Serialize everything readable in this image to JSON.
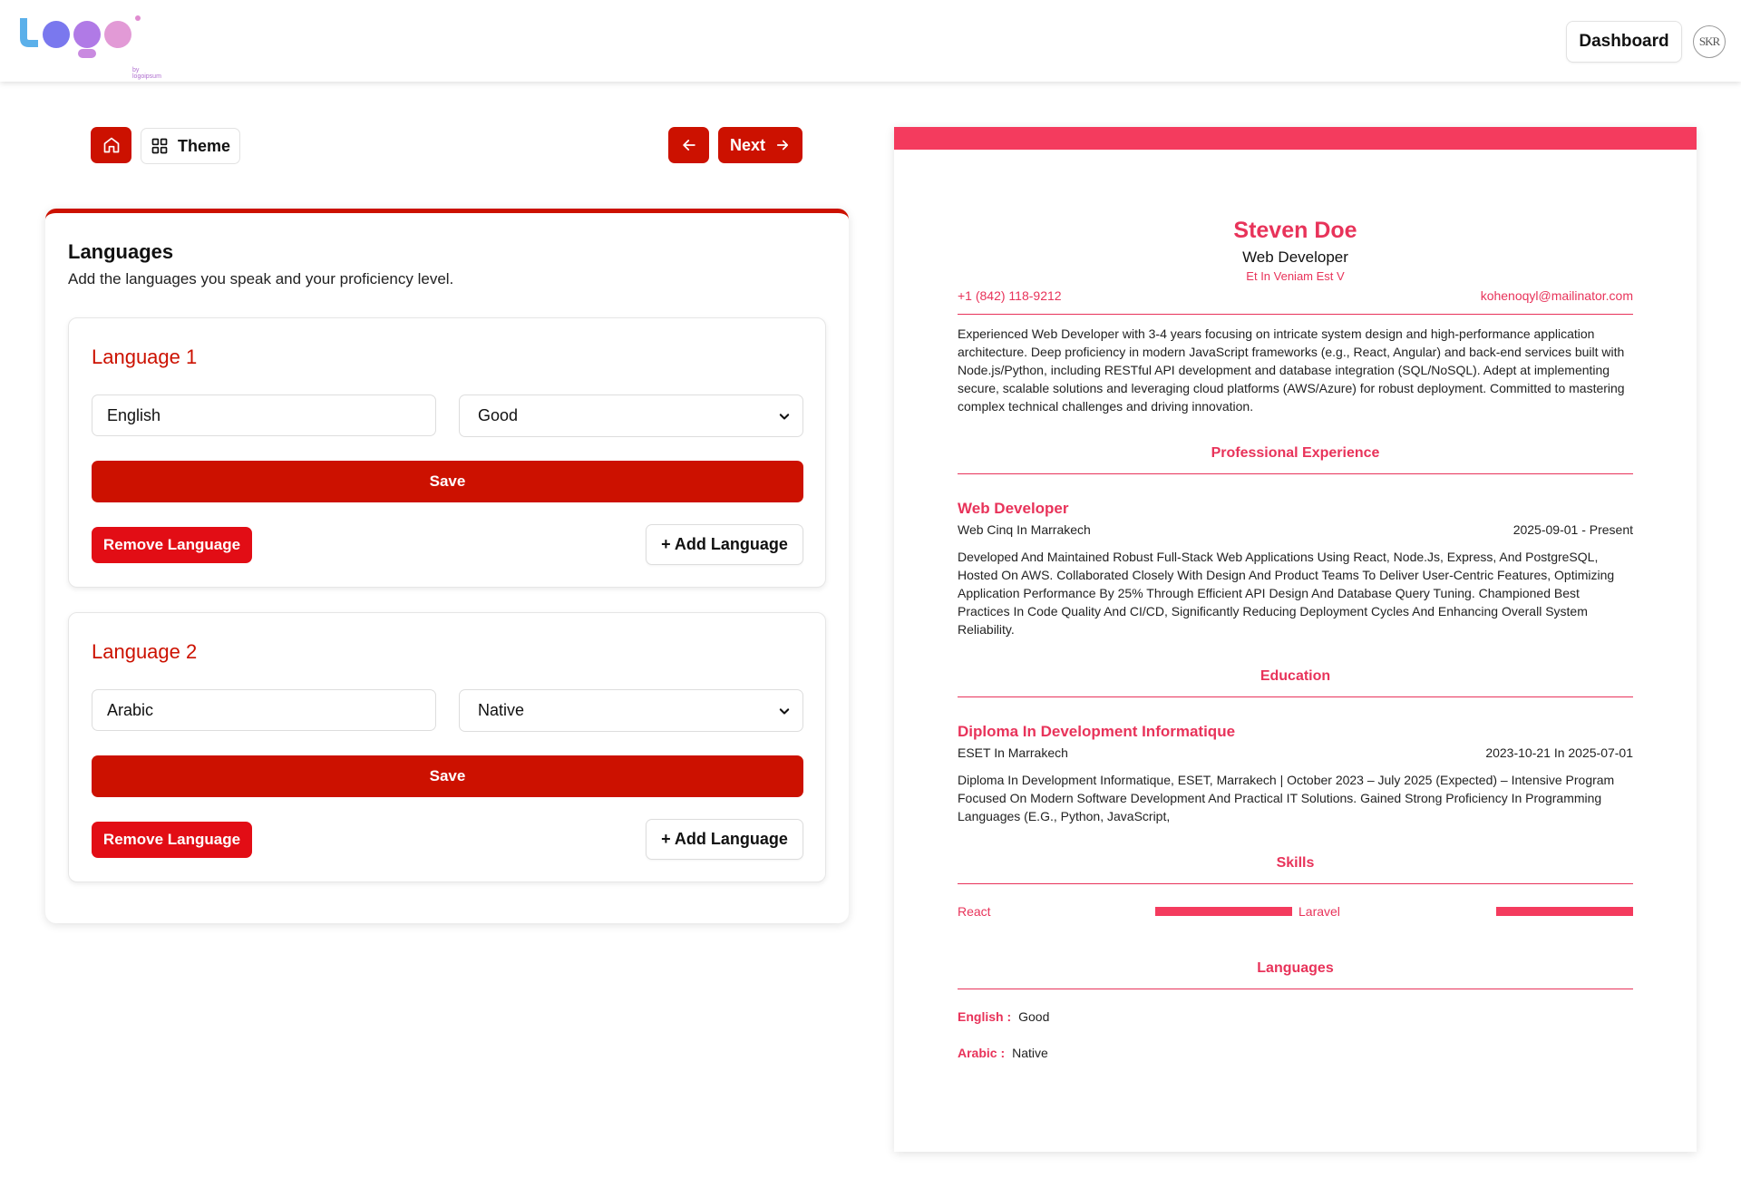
{
  "header": {
    "logo_alt": "Logo",
    "logo_sub": "by logoipsum",
    "dashboard_label": "Dashboard",
    "avatar_initials": "SKR"
  },
  "toolbar": {
    "theme_label": "Theme",
    "next_label": "Next"
  },
  "form": {
    "title": "Languages",
    "subtitle": "Add the languages you speak and your proficiency level.",
    "languages": [
      {
        "heading": "Language 1",
        "name": "English",
        "level": "Good",
        "save_label": "Save",
        "remove_label": "Remove Language",
        "add_label": "+ Add Language"
      },
      {
        "heading": "Language 2",
        "name": "Arabic",
        "level": "Native",
        "save_label": "Save",
        "remove_label": "Remove Language",
        "add_label": "+ Add Language"
      }
    ]
  },
  "resume": {
    "name": "Steven Doe",
    "role": "Web Developer",
    "location": "Et In Veniam Est V",
    "phone": "+1 (842) 118-9212",
    "email": "kohenoqyl@mailinator.com",
    "summary": "Experienced Web Developer with 3-4 years focusing on intricate system design and high-performance application architecture. Deep proficiency in modern JavaScript frameworks (e.g., React, Angular) and back-end services built with Node.js/Python, including RESTful API development and database integration (SQL/NoSQL). Adept at implementing secure, scalable solutions and leveraging cloud platforms (AWS/Azure) for robust deployment. Committed to mastering complex technical challenges and driving innovation.",
    "experience_heading": "Professional Experience",
    "experience": {
      "title": "Web Developer",
      "company": "Web Cinq In Marrakech",
      "dates": "2025-09-01 - Present",
      "description": "Developed And Maintained Robust Full-Stack Web Applications Using React, Node.Js, Express, And PostgreSQL, Hosted On AWS. Collaborated Closely With Design And Product Teams To Deliver User-Centric Features, Optimizing Application Performance By 25% Through Efficient API Design And Database Query Tuning. Championed Best Practices In Code Quality And CI/CD, Significantly Reducing Deployment Cycles And Enhancing Overall System Reliability."
    },
    "education_heading": "Education",
    "education": {
      "title": "Diploma In Development Informatique",
      "school": "ESET In Marrakech",
      "dates": "2023-10-21 In 2025-07-01",
      "description": "Diploma In Development Informatique, ESET, Marrakech | October 2023 – July 2025 (Expected) – Intensive Program Focused On Modern Software Development And Practical IT Solutions. Gained Strong Proficiency In Programming Languages (E.G., Python, JavaScript,"
    },
    "skills_heading": "Skills",
    "skills": [
      {
        "name": "React",
        "level": 1.0
      },
      {
        "name": "Laravel",
        "level": 1.0
      }
    ],
    "languages_heading": "Languages",
    "languages": [
      {
        "name": "English :",
        "level": "Good"
      },
      {
        "name": "Arabic :",
        "level": "Native"
      }
    ],
    "accent_color": "#e8335a"
  },
  "colors": {
    "primary_red": "#cc1100",
    "remove_red": "#e20d15",
    "resume_accent": "#f43b5e"
  },
  "icons": {
    "home": "home-icon",
    "theme": "grid-icon",
    "back": "arrow-left-icon",
    "next": "arrow-right-icon",
    "select": "chevron-down-icon"
  }
}
